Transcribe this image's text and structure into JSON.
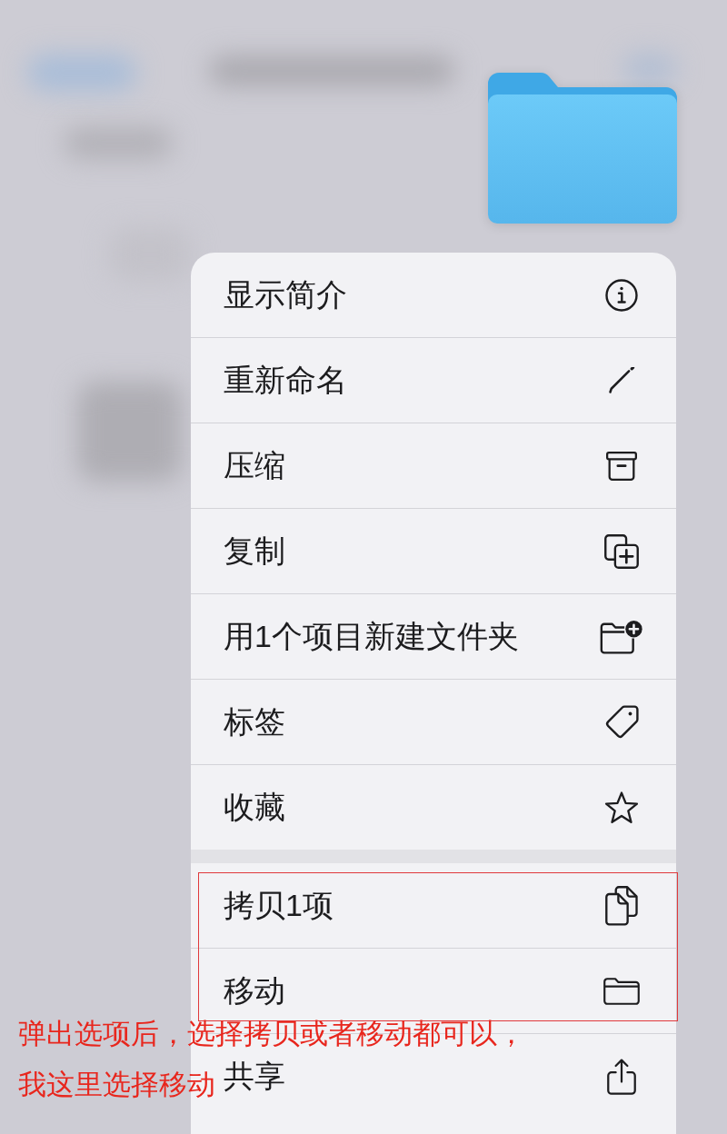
{
  "menu": {
    "groups": [
      {
        "items": [
          {
            "label": "显示简介",
            "outlined": false
          },
          {
            "label": "重新命名",
            "outlined": false
          },
          {
            "label": "压缩",
            "outlined": false
          },
          {
            "label": "复制",
            "outlined": false
          },
          {
            "label": "用1个项目新建文件夹",
            "outlined": false
          },
          {
            "label": "标签",
            "outlined": false
          },
          {
            "label": "收藏",
            "outlined": false
          }
        ]
      },
      {
        "items": [
          {
            "label": "拷贝1项",
            "outlined": true
          },
          {
            "label": "移动",
            "outlined": true
          },
          {
            "label": "共享",
            "outlined": false
          }
        ]
      }
    ]
  },
  "annotation": {
    "lines": [
      "弹出选项后，选择拷贝或者移动都可以，",
      "我这里选择移动"
    ]
  }
}
